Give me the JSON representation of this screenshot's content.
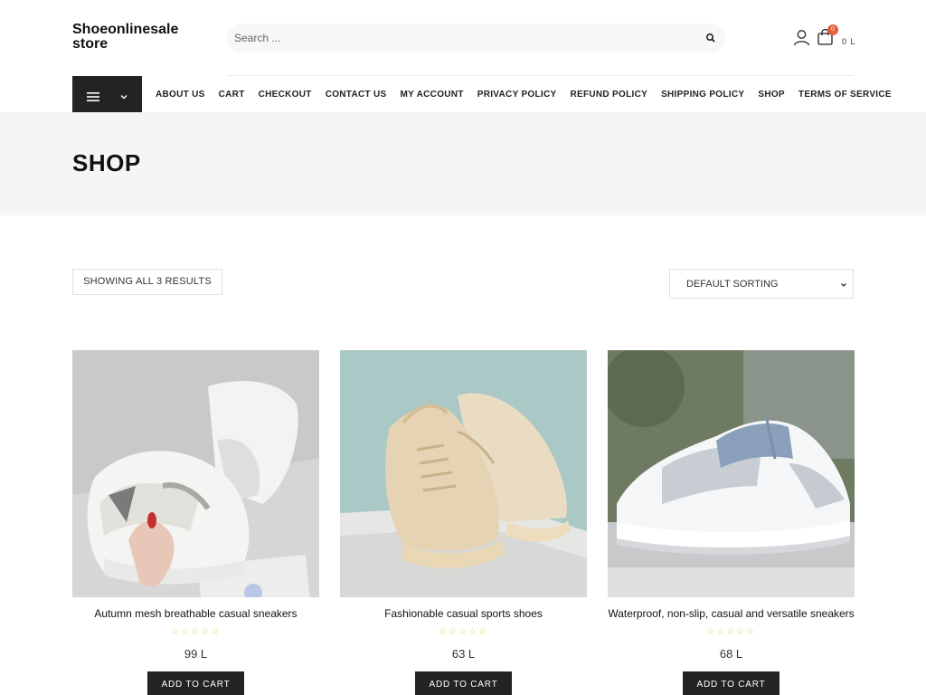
{
  "header": {
    "brand": "Shoeonlinesale store",
    "search_placeholder": "Search ...",
    "cart_count": "0",
    "cart_total": "0 L"
  },
  "nav": {
    "items": [
      "ABOUT US",
      "CART",
      "CHECKOUT",
      "CONTACT US",
      "MY ACCOUNT",
      "PRIVACY POLICY",
      "REFUND POLICY",
      "SHIPPING POLICY",
      "SHOP",
      "TERMS OF SERVICE"
    ]
  },
  "page": {
    "title": "SHOP"
  },
  "toolbar": {
    "results": "SHOWING ALL 3 RESULTS",
    "sort_selected": "DEFAULT SORTING"
  },
  "products": [
    {
      "name": "Autumn mesh breathable casual sneakers",
      "stars": "☆☆☆☆☆",
      "price": "99 L",
      "button": "ADD TO CART"
    },
    {
      "name": "Fashionable casual sports shoes",
      "stars": "☆☆☆☆☆",
      "price": "63 L",
      "button": "ADD TO CART"
    },
    {
      "name": "Waterproof, non-slip, casual and versatile sneakers",
      "stars": "☆☆☆☆☆",
      "price": "68 L",
      "button": "ADD TO CART"
    }
  ],
  "colors": {
    "dark": "#232323",
    "accent_badge": "#e35f3b",
    "banner": "#f5f5f5"
  }
}
